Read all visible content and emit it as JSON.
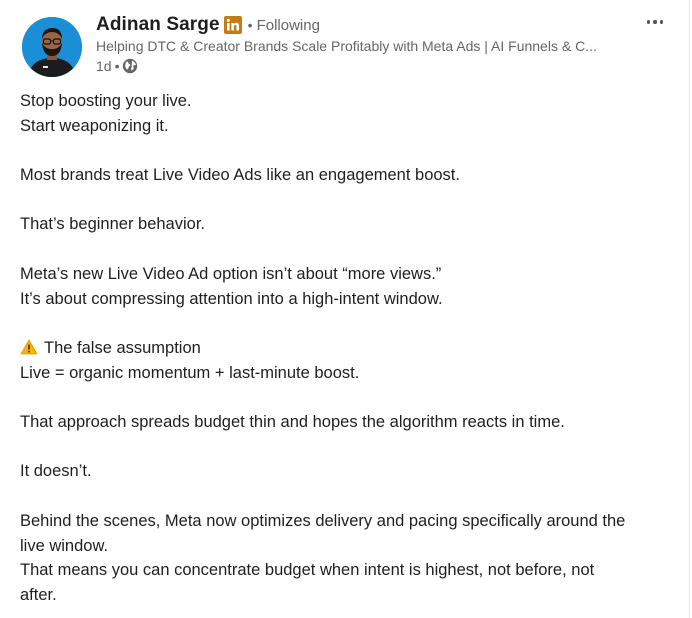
{
  "post": {
    "author": {
      "name": "Adinan Sarge",
      "badge_icon": "linkedin-icon",
      "follow_status": "Following",
      "headline": "Helping DTC & Creator Brands Scale Profitably with Meta Ads | AI Funnels & C...",
      "time": "1d",
      "visibility_icon": "globe-icon"
    },
    "menu_icon": "more-options-icon",
    "body": {
      "p1_l1": "Stop boosting your live.",
      "p1_l2": "Start weaponizing it.",
      "p2": "Most brands treat Live Video Ads like an engagement boost.",
      "p3": "That’s beginner behavior.",
      "p4_l1": "Meta’s new Live Video Ad option isn’t about “more views.”",
      "p4_l2": "It’s about compressing attention into a high-intent window.",
      "p5_l1": "The false assumption",
      "p5_l2": "Live = organic momentum + last-minute boost.",
      "p6": "That approach spreads budget thin and hopes the algorithm reacts in time.",
      "p7": "It doesn’t.",
      "p8_l1": "Behind the scenes, Meta now optimizes delivery and pacing specifically around the",
      "p8_l2": "live window.",
      "p8_l3": "That means you can concentrate budget when intent is highest, not before, not",
      "p8_l4": "after."
    }
  },
  "colors": {
    "linkedin_badge": "#c37d16",
    "avatar_bg": "#1a8fd8",
    "secondary_text": "#666666",
    "primary_text": "#1f1f1f"
  }
}
